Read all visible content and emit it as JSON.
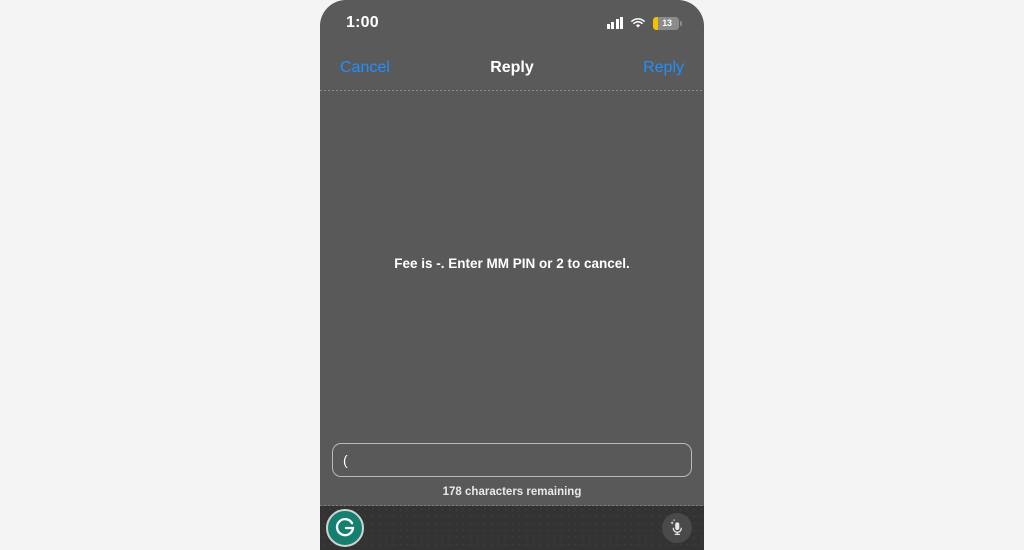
{
  "colors": {
    "page_background": "#f4f4f4",
    "screen_background": "#595959",
    "accent_blue": "#1e90ff",
    "battery_low_yellow": "#f2c200",
    "grammarly_teal": "#15806f",
    "keyboard_bar": "#333333"
  },
  "status_bar": {
    "time": "1:00",
    "signal_icon": "cellular-signal-icon",
    "wifi_icon": "wifi-icon",
    "battery": {
      "icon": "battery-icon",
      "level_text": "13"
    }
  },
  "nav_bar": {
    "cancel_label": "Cancel",
    "title": "Reply",
    "reply_label": "Reply"
  },
  "message": {
    "text": "Fee is -. Enter MM PIN or 2 to cancel."
  },
  "compose": {
    "input_value": "(",
    "input_placeholder": "",
    "character_counter": "178 characters remaining"
  },
  "keyboard_bar": {
    "grammarly_icon": "grammarly-logo-icon",
    "grammarly_letter": "G",
    "dictation_icon": "microphone-sparkle-icon"
  }
}
